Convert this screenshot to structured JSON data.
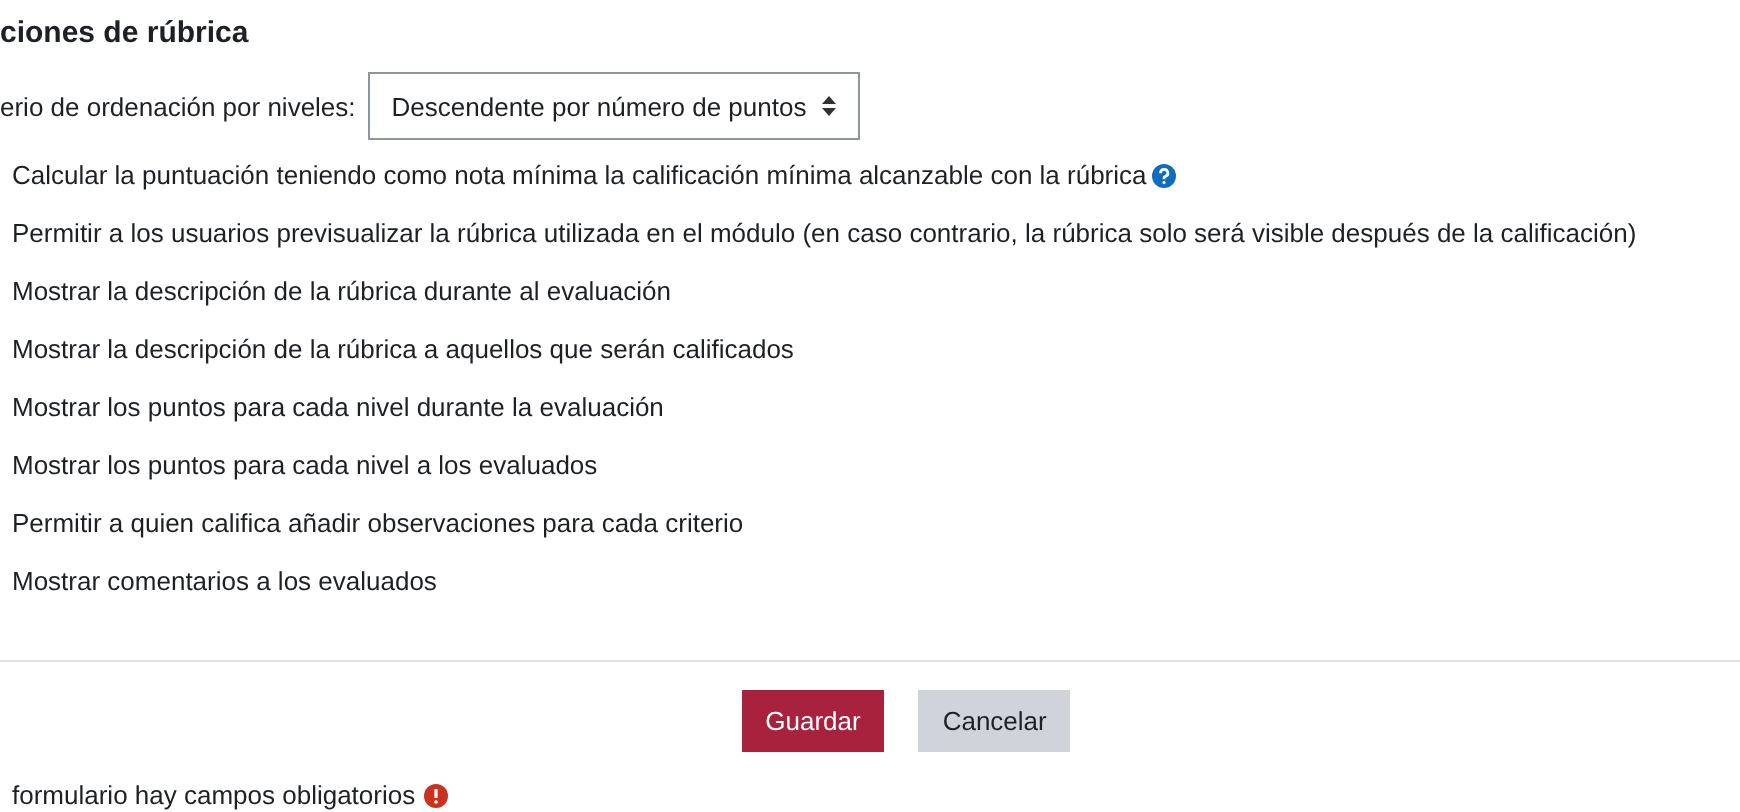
{
  "section_title": "ciones de rúbrica",
  "sort_order": {
    "label": "erio de ordenación por niveles:",
    "value": "Descendente por número de puntos"
  },
  "options": [
    {
      "label": "Calcular la puntuación teniendo como nota mínima la calificación mínima alcanzable con la rúbrica",
      "help": true
    },
    {
      "label": "Permitir a los usuarios previsualizar la rúbrica utilizada en el módulo (en caso contrario, la rúbrica solo será visible después de la calificación)",
      "help": false
    },
    {
      "label": "Mostrar la descripción de la rúbrica durante al evaluación",
      "help": false
    },
    {
      "label": "Mostrar la descripción de la rúbrica a aquellos que serán calificados",
      "help": false
    },
    {
      "label": "Mostrar los puntos para cada nivel durante la evaluación",
      "help": false
    },
    {
      "label": "Mostrar los puntos para cada nivel a los evaluados",
      "help": false
    },
    {
      "label": "Permitir a quien califica añadir observaciones para cada criterio",
      "help": false
    },
    {
      "label": "Mostrar comentarios a los evaluados",
      "help": false
    }
  ],
  "buttons": [
    {
      "label": "Guardar",
      "kind": "primary"
    },
    {
      "label": "Cancelar",
      "kind": "secondary"
    }
  ],
  "required_note": "formulario hay campos obligatorios"
}
